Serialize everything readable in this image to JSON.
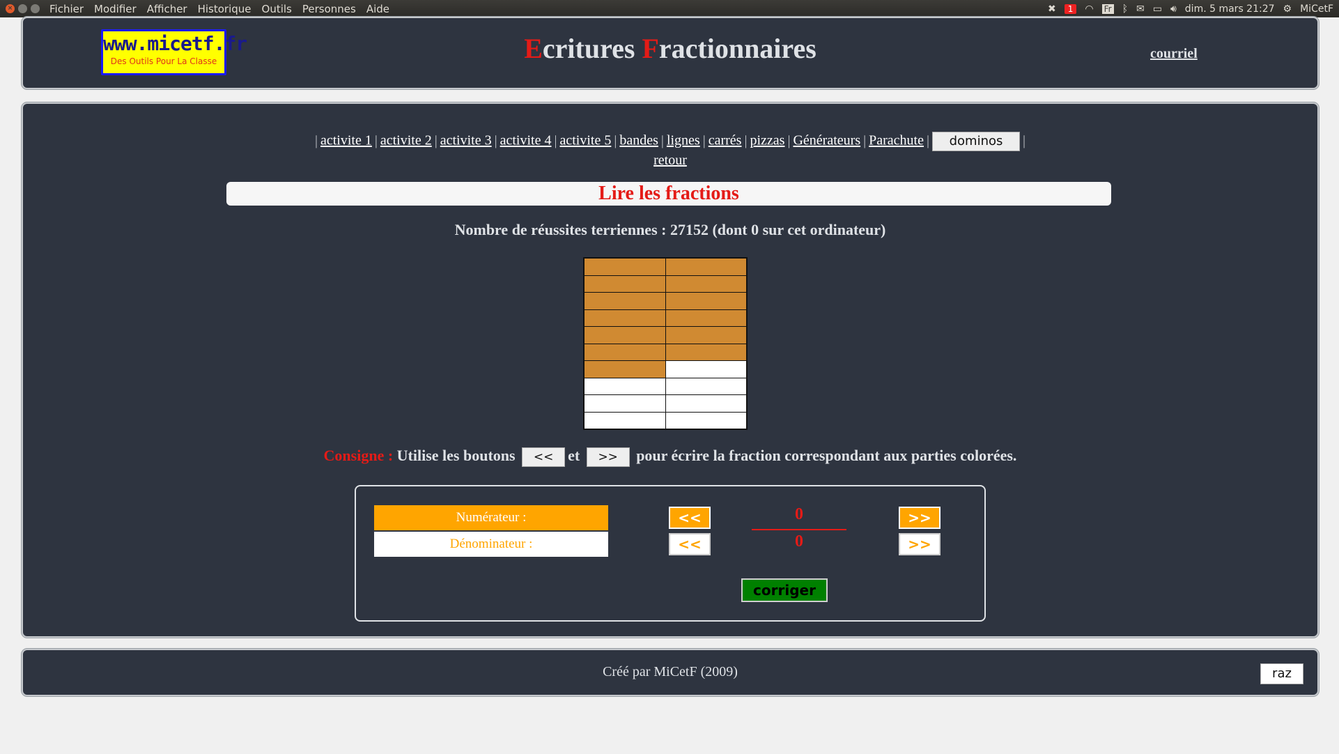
{
  "menubar": {
    "menus": [
      "Fichier",
      "Modifier",
      "Afficher",
      "Historique",
      "Outils",
      "Personnes",
      "Aide"
    ],
    "tray": {
      "notification_count": "1",
      "keyboard_layout": "Fr",
      "datetime": "dim. 5 mars 21:27",
      "user": "MiCetF"
    }
  },
  "header": {
    "logo_main": "www.micetf.fr",
    "logo_sub": "Des Outils Pour La Classe",
    "title_first_letter_1": "E",
    "title_rest_1": "critures ",
    "title_first_letter_2": "F",
    "title_rest_2": "ractionnaires",
    "courriel": "courriel"
  },
  "nav": {
    "links": [
      "activite 1",
      "activite 2",
      "activite 3",
      "activite 4",
      "activite 5",
      "bandes",
      "lignes",
      "carrés",
      "pizzas",
      "Générateurs",
      "Parachute"
    ],
    "dominos_button": "dominos",
    "retour": "retour"
  },
  "activity": {
    "title": "Lire les fractions",
    "stats": "Nombre de réussites terriennes :  27152 (dont  0 sur cet ordinateur)"
  },
  "grid": {
    "columns": 2,
    "rows": 10,
    "colored_parts": 13,
    "color_on": "#d08a32",
    "color_off": "#ffffff"
  },
  "consigne": {
    "label": "Consigne :",
    "text_1": "Utilise les boutons",
    "btn_prev": "<<",
    "text_2": "et",
    "btn_next": ">>",
    "text_3": "pour écrire la fraction correspondant aux parties colorées."
  },
  "answer": {
    "numerator_label": "Numérateur :",
    "denominator_label": "Dénominateur :",
    "numerator_value": "0",
    "denominator_value": "0",
    "prev": "<<",
    "next": ">>",
    "corriger": "corriger"
  },
  "footer": {
    "credit": "Créé par MiCetF (2009)",
    "raz": "raz"
  }
}
